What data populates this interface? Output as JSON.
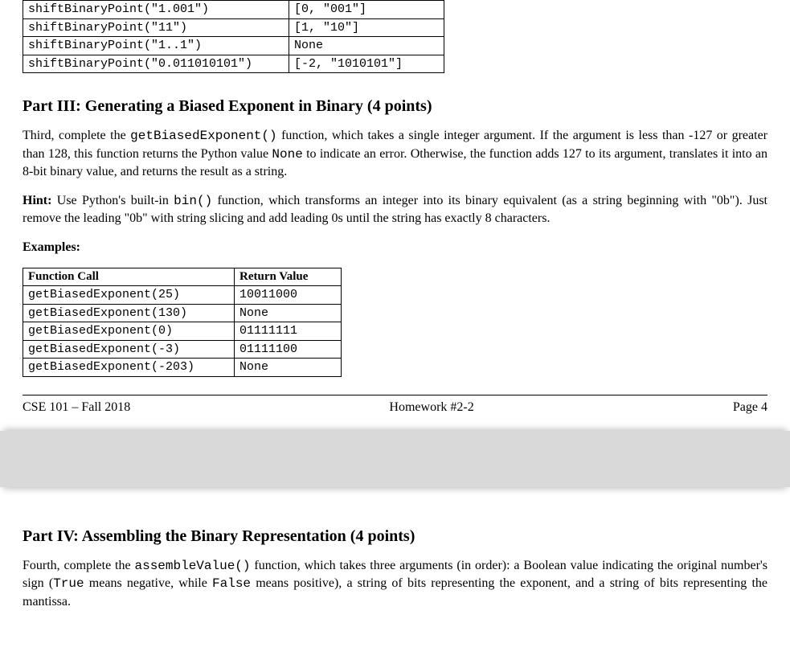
{
  "table1": {
    "rows": [
      {
        "call": "shiftBinaryPoint(\"1.001\")",
        "ret": "[0, \"001\"]"
      },
      {
        "call": "shiftBinaryPoint(\"11\")",
        "ret": "[1, \"10\"]"
      },
      {
        "call": "shiftBinaryPoint(\"1..1\")",
        "ret": "None"
      },
      {
        "call": "shiftBinaryPoint(\"0.011010101\")",
        "ret": "[-2, \"1010101\"]"
      }
    ]
  },
  "part3": {
    "heading": "Part III: Generating a Biased Exponent in Binary (4 points)",
    "para1_a": "Third, complete the ",
    "para1_code": "getBiasedExponent()",
    "para1_b": " function, which takes a single integer argument. If the argument is less than -127 or greater than 128, this function returns the Python value ",
    "para1_none": "None",
    "para1_c": " to indicate an error. Otherwise, the function adds 127 to its argument, translates it into an 8-bit binary value, and returns the result as a string.",
    "hint_label": "Hint:",
    "hint_a": " Use Python's built-in ",
    "hint_code": "bin()",
    "hint_b": " function, which transforms an integer into its binary equivalent (as a string beginning with \"0b\"). Just remove the leading \"0b\" with string slicing and add leading 0s until the string has exactly 8 characters.",
    "examples_label": "Examples:"
  },
  "table2": {
    "headers": [
      "Function Call",
      "Return Value"
    ],
    "rows": [
      {
        "call": "getBiasedExponent(25)",
        "ret": "10011000"
      },
      {
        "call": "getBiasedExponent(130)",
        "ret": "None"
      },
      {
        "call": "getBiasedExponent(0)",
        "ret": "01111111"
      },
      {
        "call": "getBiasedExponent(-3)",
        "ret": "01111100"
      },
      {
        "call": "getBiasedExponent(-203)",
        "ret": "None"
      }
    ]
  },
  "footer": {
    "left": "CSE 101 – Fall 2018",
    "center": "Homework #2-2",
    "right": "Page 4"
  },
  "part4": {
    "heading": "Part IV: Assembling the Binary Representation (4 points)",
    "para_a": "Fourth, complete the ",
    "para_code": "assembleValue()",
    "para_b": " function, which takes three arguments (in order): a Boolean value indicating the original number's sign (",
    "true_code": "True",
    "para_c": " means negative, while ",
    "false_code": "False",
    "para_d": " means positive), a string of bits representing the exponent, and a string of bits representing the mantissa."
  }
}
